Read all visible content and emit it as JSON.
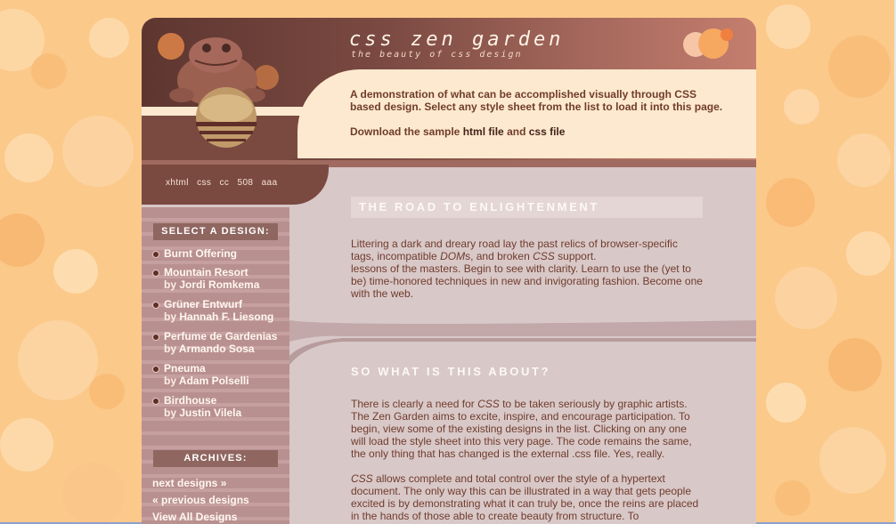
{
  "header": {
    "logo_text": "css zen garden",
    "tagline": "the beauty of css design",
    "intro_paragraph": "A demonstration of what can be accomplished visually through CSS based design. Select any style sheet from the list to load it into this page.",
    "download_prefix": "Download the sample",
    "html_link": "html file",
    "and_text": "and",
    "css_link": "css file"
  },
  "nav_links": [
    "xhtml",
    "css",
    "cc",
    "508",
    "aaa"
  ],
  "sidebar": {
    "select_heading": "SELECT A DESIGN:",
    "designs": [
      {
        "name": "Burnt Offering",
        "by": "",
        "author": ""
      },
      {
        "name": "Mountain Resort",
        "by": "by",
        "author": "Jordi Romkema"
      },
      {
        "name": "Grüner Entwurf",
        "by": "by",
        "author": "Hannah F. Liesong"
      },
      {
        "name": "Perfume de Gardenias",
        "by": "by",
        "author": "Armando Sosa"
      },
      {
        "name": "Pneuma",
        "by": "by",
        "author": "Adam Polselli"
      },
      {
        "name": "Birdhouse",
        "by": "by",
        "author": "Justin Vilela"
      }
    ],
    "archives_heading": "ARCHIVES:",
    "archive_links": [
      "next designs »",
      "« previous designs",
      "View All Designs"
    ]
  },
  "main": {
    "section1_title": "THE ROAD TO ENLIGHTENMENT",
    "section1_text_a": "Littering a dark and dreary road lay the past relics of browser-specific tags, incompatible ",
    "section1_dom": "DOM",
    "section1_text_b": "s, and broken ",
    "section1_css": "CSS",
    "section1_text_c": " support.",
    "section1_text_d": "lessons of the masters. Begin to see with clarity. Learn to use the (yet to be) time-honored techniques in new and invigorating fashion. Become one with the web.",
    "section2_title": "SO WHAT IS THIS ABOUT?",
    "section2_p1_a": "There is clearly a need for ",
    "section2_p1_css": "CSS",
    "section2_p1_b": " to be taken seriously by graphic artists. The Zen Garden aims to excite, inspire, and encourage participation. To begin, view some of the existing designs in the list. Clicking on any one will load the style sheet into this very page. The code remains the same, the only thing that has changed is the external .css file. Yes, really.",
    "section2_p2_css": "CSS",
    "section2_p2_b": " allows complete and total control over the style of a hypertext document. The only way this can be illustrated in a way that gets people excited is by demonstrating what it can truly be, once the reins are placed in the hands of those able to create beauty from structure. To"
  },
  "colors": {
    "page_bg": "#fbc98a",
    "header_brown": "#7a4a40",
    "panel_cream": "#fde9cf",
    "text_brown": "#703c2c",
    "content_mauve": "#d8c8c8"
  }
}
